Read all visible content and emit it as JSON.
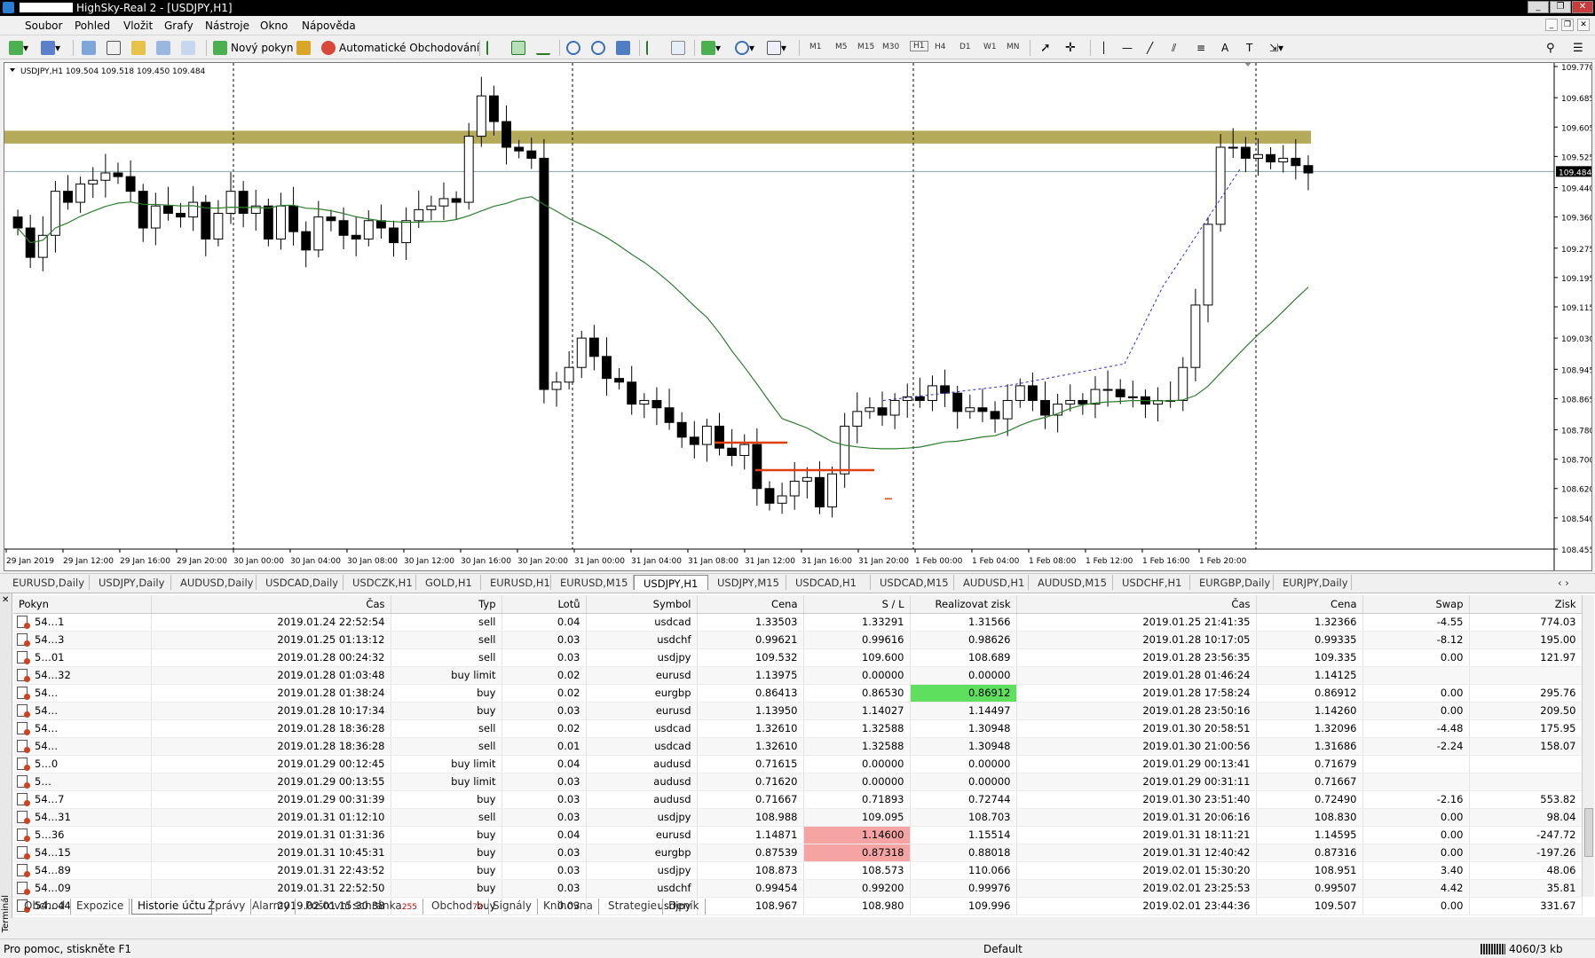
{
  "window": {
    "title": "HighSky-Real 2 - [USDJPY,H1]"
  },
  "menu": [
    "Soubor",
    "Pohled",
    "Vložit",
    "Grafy",
    "Nástroje",
    "Okno",
    "Nápověda"
  ],
  "toolbar": {
    "new_order": "Nový pokyn",
    "autotrading": "Automatické Obchodování",
    "timeframes": [
      "M1",
      "M5",
      "M15",
      "M30",
      "H1",
      "H4",
      "D1",
      "W1",
      "MN"
    ]
  },
  "chart": {
    "header": "USDJPY,H1  109.504 109.518 109.450 109.484",
    "current_price": "109.484",
    "yticks": [
      "109.770",
      "109.685",
      "109.605",
      "109.525",
      "109.440",
      "109.360",
      "109.275",
      "109.195",
      "109.115",
      "109.030",
      "108.945",
      "108.865",
      "108.780",
      "108.700",
      "108.620",
      "108.540",
      "108.455"
    ],
    "xticks": [
      "29 Jan 2019",
      "29 Jan 12:00",
      "29 Jan 16:00",
      "29 Jan 20:00",
      "30 Jan 00:00",
      "30 Jan 04:00",
      "30 Jan 08:00",
      "30 Jan 12:00",
      "30 Jan 16:00",
      "30 Jan 20:00",
      "31 Jan 00:00",
      "31 Jan 04:00",
      "31 Jan 08:00",
      "31 Jan 12:00",
      "31 Jan 16:00",
      "31 Jan 20:00",
      "1 Feb 00:00",
      "1 Feb 04:00",
      "1 Feb 08:00",
      "1 Feb 12:00",
      "1 Feb 16:00",
      "1 Feb 20:00"
    ]
  },
  "chart_tabs": [
    "EURUSD,Daily",
    "USDJPY,Daily",
    "AUDUSD,Daily",
    "USDCAD,Daily",
    "USDCZK,H1",
    "GOLD,H1",
    "EURUSD,H1",
    "EURUSD,M15",
    "USDJPY,H1",
    "USDJPY,M15",
    "USDCAD,H1",
    "USDCAD,M15",
    "AUDUSD,H1",
    "AUDUSD,M15",
    "USDCHF,H1",
    "EURGBP,Daily",
    "EURJPY,Daily"
  ],
  "table": {
    "headers": [
      "Pokyn",
      "Čas",
      "Typ",
      "Lotů",
      "Symbol",
      "Cena",
      "S / L",
      "Realizovat zisk",
      "Čas",
      "Cena",
      "Swap",
      "Zisk"
    ],
    "rows": [
      [
        "54…1",
        "2019.01.24 22:52:54",
        "sell",
        "0.04",
        "usdcad",
        "1.33503",
        "1.33291",
        "1.31566",
        "2019.01.25 21:41:35",
        "1.32366",
        "-4.55",
        "774.03"
      ],
      [
        "54…3",
        "2019.01.25 01:13:12",
        "sell",
        "0.03",
        "usdchf",
        "0.99621",
        "0.99616",
        "0.98626",
        "2019.01.28 10:17:05",
        "0.99335",
        "-8.12",
        "195.00"
      ],
      [
        "5…01",
        "2019.01.28 00:24:32",
        "sell",
        "0.03",
        "usdjpy",
        "109.532",
        "109.600",
        "108.689",
        "2019.01.28 23:56:35",
        "109.335",
        "0.00",
        "121.97"
      ],
      [
        "54…32",
        "2019.01.28 01:03:48",
        "buy limit",
        "0.02",
        "eurusd",
        "1.13975",
        "0.00000",
        "0.00000",
        "2019.01.28 01:46:24",
        "1.14125",
        "",
        ""
      ],
      [
        "54…",
        "2019.01.28 01:38:24",
        "buy",
        "0.02",
        "eurgbp",
        "0.86413",
        "0.86530",
        "0.86912",
        "2019.01.28 17:58:24",
        "0.86912",
        "0.00",
        "295.76"
      ],
      [
        "54…",
        "2019.01.28 10:17:34",
        "buy",
        "0.03",
        "eurusd",
        "1.13950",
        "1.14027",
        "1.14497",
        "2019.01.28 23:50:16",
        "1.14260",
        "0.00",
        "209.50"
      ],
      [
        "54…",
        "2019.01.28 18:36:28",
        "sell",
        "0.02",
        "usdcad",
        "1.32610",
        "1.32588",
        "1.30948",
        "2019.01.30 20:58:51",
        "1.32096",
        "-4.48",
        "175.95"
      ],
      [
        "54…",
        "2019.01.28 18:36:28",
        "sell",
        "0.01",
        "usdcad",
        "1.32610",
        "1.32588",
        "1.30948",
        "2019.01.30 21:00:56",
        "1.31686",
        "-2.24",
        "158.07"
      ],
      [
        "5…0",
        "2019.01.29 00:12:45",
        "buy limit",
        "0.04",
        "audusd",
        "0.71615",
        "0.00000",
        "0.00000",
        "2019.01.29 00:13:41",
        "0.71679",
        "",
        ""
      ],
      [
        "5…",
        "2019.01.29 00:13:55",
        "buy limit",
        "0.03",
        "audusd",
        "0.71620",
        "0.00000",
        "0.00000",
        "2019.01.29 00:31:11",
        "0.71667",
        "",
        ""
      ],
      [
        "54…7",
        "2019.01.29 00:31:39",
        "buy",
        "0.03",
        "audusd",
        "0.71667",
        "0.71893",
        "0.72744",
        "2019.01.30 23:51:40",
        "0.72490",
        "-2.16",
        "553.82"
      ],
      [
        "54…31",
        "2019.01.31 01:12:10",
        "sell",
        "0.03",
        "usdjpy",
        "108.988",
        "109.095",
        "108.703",
        "2019.01.31 20:06:16",
        "108.830",
        "0.00",
        "98.04"
      ],
      [
        "5…36",
        "2019.01.31 01:31:36",
        "buy",
        "0.04",
        "eurusd",
        "1.14871",
        "1.14600",
        "1.15514",
        "2019.01.31 18:11:21",
        "1.14595",
        "0.00",
        "-247.72"
      ],
      [
        "54…15",
        "2019.01.31 10:45:31",
        "buy",
        "0.03",
        "eurgbp",
        "0.87539",
        "0.87318",
        "0.88018",
        "2019.01.31 12:40:42",
        "0.87316",
        "0.00",
        "-197.26"
      ],
      [
        "54…89",
        "2019.01.31 22:43:52",
        "buy",
        "0.03",
        "usdjpy",
        "108.873",
        "108.573",
        "110.066",
        "2019.02.01 15:30:20",
        "108.951",
        "3.40",
        "48.06"
      ],
      [
        "54…09",
        "2019.01.31 22:52:50",
        "buy",
        "0.03",
        "usdchf",
        "0.99454",
        "0.99200",
        "0.99976",
        "2019.02.01 23:25:53",
        "0.99507",
        "4.42",
        "35.81"
      ],
      [
        "54…44",
        "2019.02.01 15:30:38",
        "buy",
        "0.03",
        "usdjpy",
        "108.967",
        "108.980",
        "109.996",
        "2019.02.01 23:44:36",
        "109.507",
        "0.00",
        "331.67"
      ]
    ]
  },
  "terminal_tabs": [
    {
      "label": "Obchod",
      "badge": ""
    },
    {
      "label": "Expozice",
      "badge": ""
    },
    {
      "label": "Historie účtu",
      "badge": ""
    },
    {
      "label": "Zprávy",
      "badge": ""
    },
    {
      "label": "Alarmy",
      "badge": ""
    },
    {
      "label": "Poštovní schránka",
      "badge": "255"
    },
    {
      "label": "Obchod",
      "badge": "72"
    },
    {
      "label": "Signály",
      "badge": ""
    },
    {
      "label": "Knihovna",
      "badge": ""
    },
    {
      "label": "Strategie",
      "badge": ""
    },
    {
      "label": "Deník",
      "badge": ""
    }
  ],
  "terminal_label": "Terminál",
  "status": {
    "help": "Pro pomoc, stiskněte F1",
    "profile": "Default",
    "traffic": "4060/3 kb"
  },
  "colors": {
    "zone": "#b5a95a",
    "ma": "#2e7d2e",
    "levels": "#e04010",
    "highlight_green": "#5ee05e",
    "highlight_red": "#f5a3a3"
  }
}
